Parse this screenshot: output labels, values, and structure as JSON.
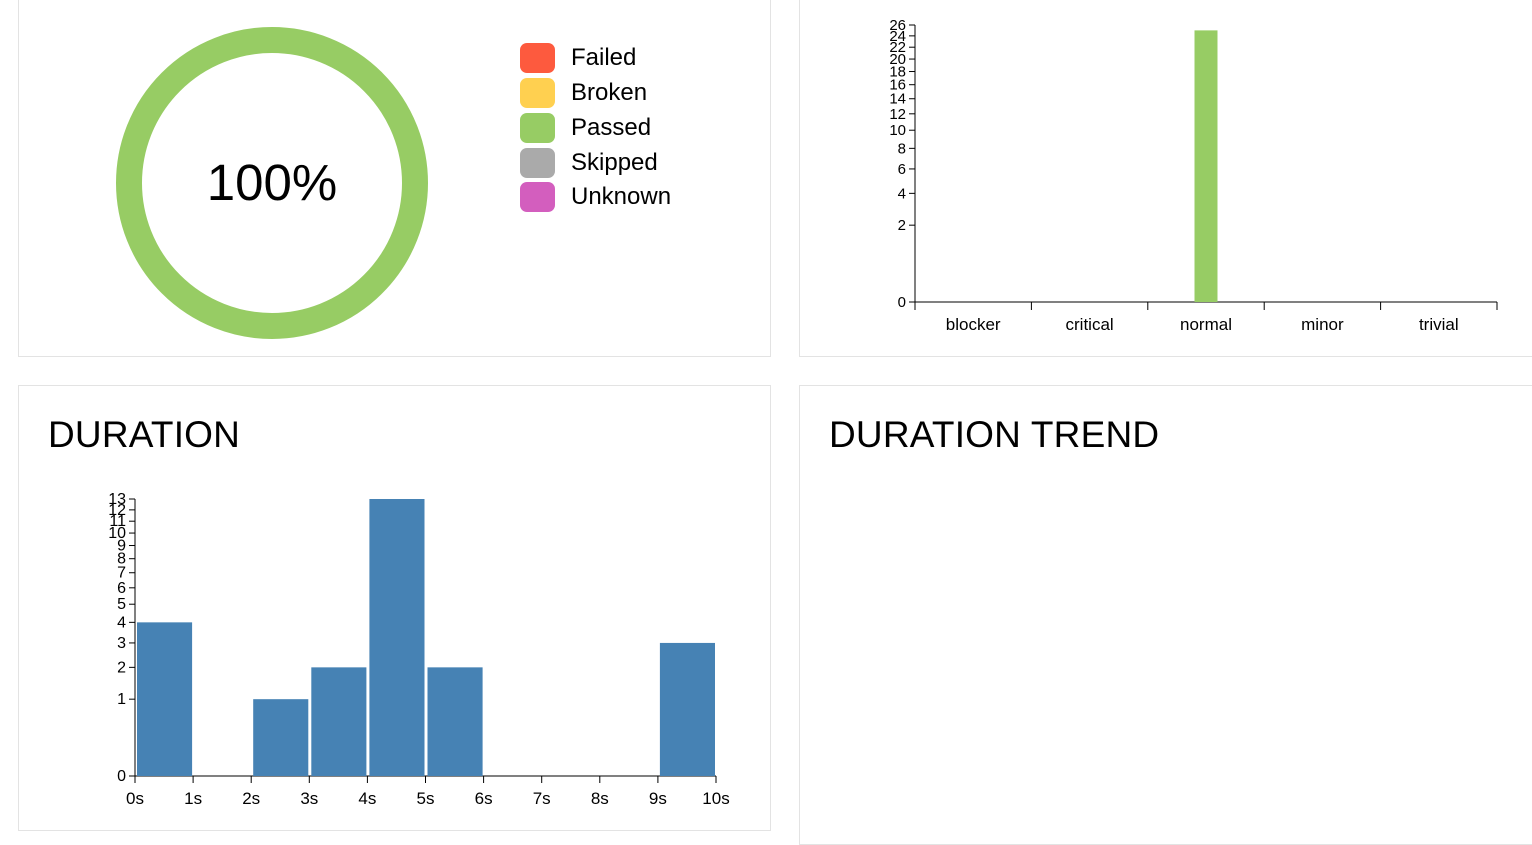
{
  "status_panel": {
    "percent_label": "100%",
    "legend": [
      {
        "label": "Failed",
        "color": "#fd5a3e",
        "icon": "failed-swatch"
      },
      {
        "label": "Broken",
        "color": "#ffd050",
        "icon": "broken-swatch"
      },
      {
        "label": "Passed",
        "color": "#97cc64",
        "icon": "passed-swatch"
      },
      {
        "label": "Skipped",
        "color": "#aaaaaa",
        "icon": "skipped-swatch"
      },
      {
        "label": "Unknown",
        "color": "#d35ebe",
        "icon": "unknown-swatch"
      }
    ]
  },
  "duration_panel": {
    "title": "DURATION"
  },
  "trend_panel": {
    "title": "DURATION TREND"
  },
  "chart_data": [
    {
      "type": "pie",
      "variant": "donut",
      "labels": [
        "Failed",
        "Broken",
        "Passed",
        "Skipped",
        "Unknown"
      ],
      "values": [
        0,
        0,
        100,
        0,
        0
      ],
      "colors": [
        "#fd5a3e",
        "#ffd050",
        "#97cc64",
        "#aaaaaa",
        "#d35ebe"
      ],
      "center_label": "100%",
      "legend_position": "right"
    },
    {
      "type": "bar",
      "categories": [
        "blocker",
        "critical",
        "normal",
        "minor",
        "trivial"
      ],
      "series": [
        {
          "values": [
            0,
            0,
            25,
            0,
            0
          ],
          "color": "#97cc64"
        }
      ],
      "ylim": [
        0,
        26
      ],
      "yscale": "sqrt",
      "yticks": [
        0,
        2,
        4,
        6,
        8,
        10,
        12,
        14,
        16,
        18,
        20,
        22,
        24,
        26
      ],
      "grid": false
    },
    {
      "type": "bar",
      "variant": "histogram",
      "title": "DURATION",
      "x_ticks": [
        "0s",
        "1s",
        "2s",
        "3s",
        "4s",
        "5s",
        "6s",
        "7s",
        "8s",
        "9s",
        "10s"
      ],
      "bins": [
        {
          "from": 0,
          "to": 1,
          "value": 4
        },
        {
          "from": 1,
          "to": 2,
          "value": 0
        },
        {
          "from": 2,
          "to": 3,
          "value": 1
        },
        {
          "from": 3,
          "to": 4,
          "value": 2
        },
        {
          "from": 4,
          "to": 5,
          "value": 13
        },
        {
          "from": 5,
          "to": 6,
          "value": 2
        },
        {
          "from": 6,
          "to": 7,
          "value": 0
        },
        {
          "from": 7,
          "to": 8,
          "value": 0
        },
        {
          "from": 8,
          "to": 9,
          "value": 0
        },
        {
          "from": 9,
          "to": 10,
          "value": 3
        }
      ],
      "color": "#4682b4",
      "ylim": [
        0,
        13
      ],
      "yscale": "sqrt",
      "yticks": [
        0,
        1,
        2,
        3,
        4,
        5,
        6,
        7,
        8,
        9,
        10,
        11,
        12,
        13
      ],
      "grid": false
    }
  ]
}
